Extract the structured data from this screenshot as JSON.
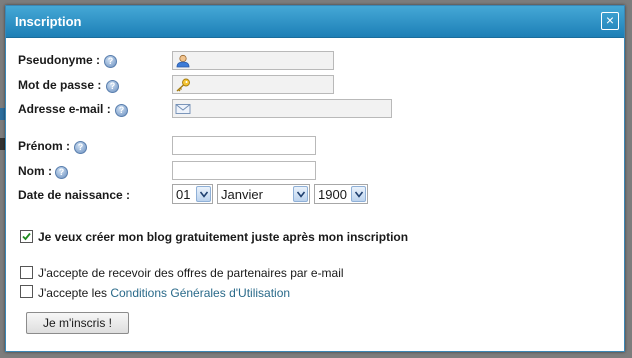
{
  "dialog": {
    "title": "Inscription",
    "close_glyph": "×"
  },
  "form": {
    "pseudonyme_label": "Pseudonyme :",
    "password_label": "Mot de passe :",
    "email_label": "Adresse e-mail :",
    "prenom_label": "Prénom :",
    "nom_label": "Nom :",
    "birthdate_label": "Date de naissance :",
    "help_glyph": "?",
    "day_value": "01",
    "month_value": "Janvier",
    "year_value": "1900"
  },
  "options": {
    "blog_label": "Je veux créer mon blog gratuitement juste après mon inscription",
    "blog_checked": true,
    "partners_label": "J'accepte de recevoir des offres de partenaires par e-mail",
    "partners_checked": false,
    "terms_prefix": "J'accepte les ",
    "terms_link": "Conditions Générales d'Utilisation",
    "terms_checked": false
  },
  "submit_label": "Je m'inscris !",
  "colors": {
    "titlebar": "#2a8fc6",
    "link": "#2a6a8a"
  },
  "icons": [
    "user-icon",
    "key-icon",
    "envelope-icon",
    "help-icon",
    "close-icon",
    "check-icon",
    "chevron-down-icon"
  ]
}
